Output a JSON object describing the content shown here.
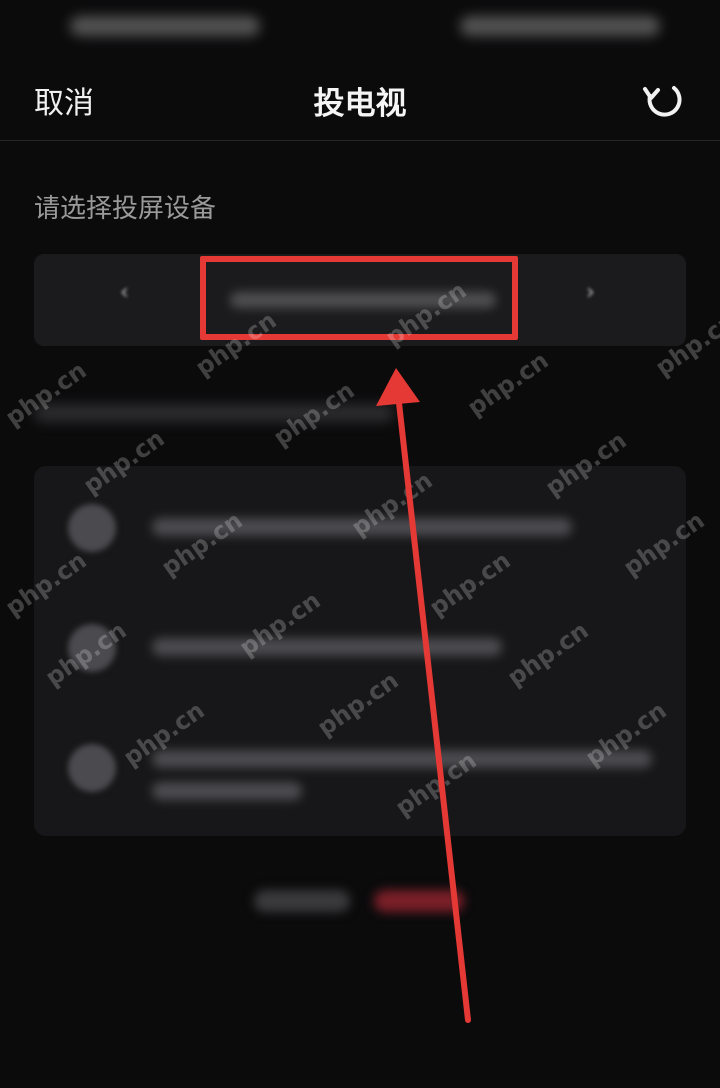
{
  "header": {
    "cancel_label": "取消",
    "title": "投电视",
    "refresh_icon": "refresh-icon"
  },
  "section": {
    "label": "请选择投屏设备"
  },
  "annotation": {
    "highlight_color": "#e53935",
    "arrow_color": "#e53935"
  },
  "watermark": {
    "text": "php.cn"
  },
  "colors": {
    "background": "#0b0b0c",
    "card": "#1b1b1d"
  }
}
